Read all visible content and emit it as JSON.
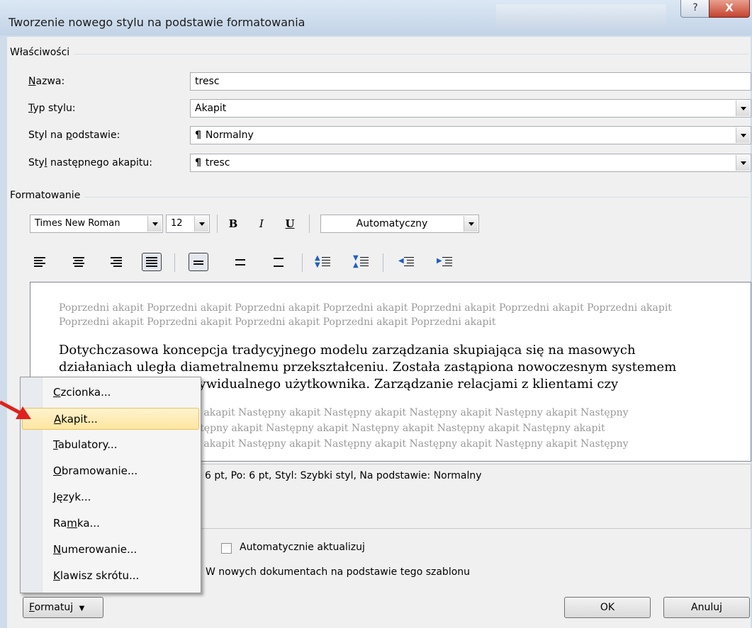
{
  "window": {
    "title": "Tworzenie nowego stylu na podstawie formatowania",
    "help_glyph": "?",
    "close_glyph": "X"
  },
  "properties": {
    "group_label": "Właściwości",
    "name_label": "Nazwa:",
    "name_value": "tresc",
    "style_type_label": "Typ stylu:",
    "style_type_value": "Akapit",
    "based_on_label": "Styl na podstawie:",
    "based_on_value": "Normalny",
    "next_style_label": "Styl następnego akapitu:",
    "next_style_value": "tresc",
    "para_glyph": "¶"
  },
  "formatting": {
    "group_label": "Formatowanie",
    "font": "Times New Roman",
    "size": "12",
    "bold": "B",
    "italic": "I",
    "underline": "U",
    "color": "Automatyczny"
  },
  "preview": {
    "previous": "Poprzedni akapit Poprzedni akapit Poprzedni akapit Poprzedni akapit Poprzedni akapit Poprzedni akapit Poprzedni akapit Poprzedni akapit Poprzedni akapit Poprzedni akapit Poprzedni akapit Poprzedni akapit",
    "main_line1": "Dotychczasowa koncepcja tradycyjnego modelu zarządzania skupiająca się na masowych",
    "main_line2": "działaniach uległa diametralnemu przekształceniu. Została zastąpiona nowoczesnym systemem",
    "main_line3_visible": "dywidualnego użytkownika. Zarządzanie relacjami z klientami czy",
    "next_line1_visible": "y akapit Następny akapit Następny akapit Następny akapit Następny akapit Następny",
    "next_line2_visible": "stępny akapit Następny akapit Następny akapit Następny akapit Następny akapit",
    "next_line3_visible": "y akapit Następny akapit Następny akapit Następny akapit Następny akapit Następny"
  },
  "description": {
    "text_visible": "6 pt, Po:  6 pt, Styl: Szybki styl, Na podstawie: Normalny"
  },
  "options": {
    "autoupdate_label": "Automatycznie aktualizuj",
    "template_label": "W nowych dokumentach na podstawie tego szablonu"
  },
  "buttons": {
    "format": "Formatuj",
    "ok": "OK",
    "cancel": "Anuluj"
  },
  "menu": {
    "items": [
      "Czcionka...",
      "Akapit...",
      "Tabulatory...",
      "Obramowanie...",
      "Język...",
      "Ramka...",
      "Numerowanie...",
      "Klawisz skrótu..."
    ],
    "highlighted_index": 1
  },
  "colors": {
    "annotation_arrow": "#e0221e",
    "menu_highlight": "#fde6a0"
  }
}
